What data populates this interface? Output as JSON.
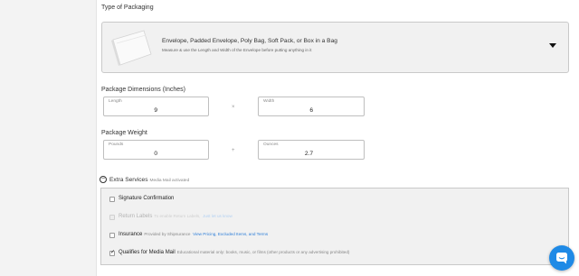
{
  "packaging": {
    "section_label": "Type of Packaging",
    "selected_title": "Envelope, Padded Envelope, Poly Bag, Soft Pack, or Box in a Bag",
    "selected_subtitle": "Measure & use the Length and Width of the Envelope before putting anything in it",
    "thumbnail_icon": "poly-mailer-icon",
    "dropdown_icon": "caret-down-icon"
  },
  "dimensions": {
    "section_label": "Package Dimensions (Inches)",
    "length_label": "Length",
    "length_value": "9",
    "separator": "×",
    "width_label": "Width",
    "width_value": "6"
  },
  "weight": {
    "section_label": "Package Weight",
    "pounds_label": "Pounds",
    "pounds_value": "0",
    "separator": "+",
    "ounces_label": "Ounces",
    "ounces_value": "2.7"
  },
  "extra_services": {
    "toggle_symbol": "−",
    "title": "Extra Services",
    "subtitle": "Media Mail activated",
    "items": [
      {
        "label": "Signature Confirmation",
        "description": "",
        "link": "",
        "checked": false,
        "disabled": false
      },
      {
        "label": "Return Labels",
        "description": "To enable Return Labels,",
        "link": "Just let us know",
        "checked": false,
        "disabled": true
      },
      {
        "label": "Insurance",
        "description": "Provided by Shipsurance",
        "link": "View Pricing, Excluded Items, and Terms",
        "checked": false,
        "disabled": false
      },
      {
        "label": "Qualifies for Media Mail",
        "description": "Educational material only: books, music, or films (other products or any advertising prohibited)",
        "link": "",
        "checked": true,
        "disabled": false
      }
    ]
  },
  "chat": {
    "icon": "chat-bubble-icon"
  },
  "colors": {
    "link": "#2f7fd8",
    "chat": "#1f8ae6",
    "panel_bg": "#f1f1f1",
    "border": "#c9c9c9"
  }
}
